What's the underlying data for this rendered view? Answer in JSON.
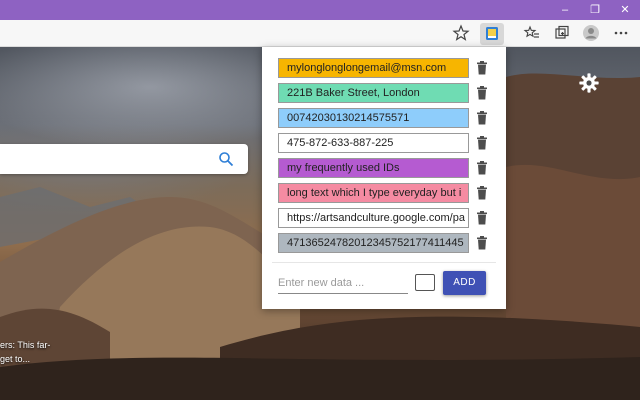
{
  "window": {
    "minimize": "–",
    "restore": "❐",
    "close": "✕"
  },
  "background": {
    "caption_line1": "ers: This far-",
    "caption_line2": "get to..."
  },
  "popup": {
    "items": [
      {
        "text": "mylonglonglongemail@msn.com",
        "color": "#f7b500"
      },
      {
        "text": "221B Baker Street, London",
        "color": "#6fdcb3"
      },
      {
        "text": "00742030130214575571",
        "color": "#8ecdfb"
      },
      {
        "text": "475-872-633-887-225",
        "color": "#ffffff"
      },
      {
        "text": "my frequently used IDs",
        "color": "#b55bd1"
      },
      {
        "text": "long text which I type everyday but i",
        "color": "#f58ba2"
      },
      {
        "text": "https://artsandculture.google.com/pa",
        "color": "#ffffff"
      },
      {
        "text": "47136524782012345752177411445",
        "color": "#aeb7bf"
      }
    ],
    "new_placeholder": "Enter new data ...",
    "add_label": "ADD",
    "accent": "#3f51b5"
  }
}
